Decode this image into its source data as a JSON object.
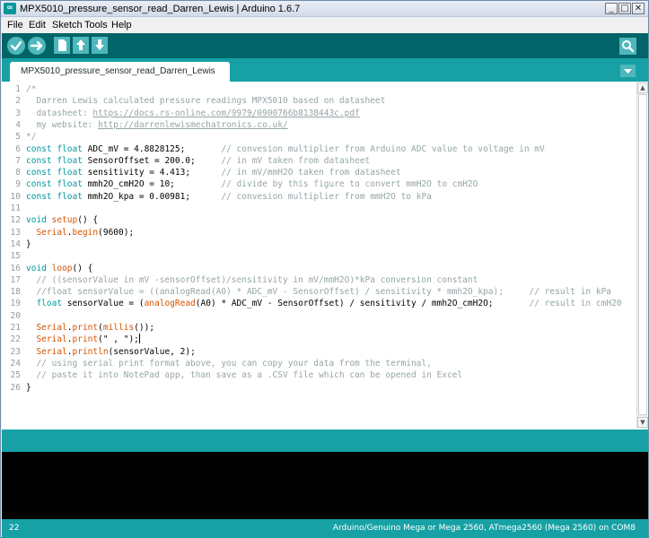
{
  "window": {
    "title": "MPX5010_pressure_sensor_read_Darren_Lewis | Arduino 1.6.7",
    "app_icon_glyph": "∞",
    "minimize_glyph": "_",
    "maximize_glyph": "□",
    "close_glyph": "✕"
  },
  "menu": [
    "File",
    "Edit",
    "Sketch",
    "Tools",
    "Help"
  ],
  "toolbar": {
    "buttons": [
      "verify-icon",
      "upload-icon",
      "new-icon",
      "open-icon",
      "save-icon"
    ],
    "right_button": "serial-monitor-icon"
  },
  "tab": {
    "label": "MPX5010_pressure_sensor_read_Darren_Lewis",
    "menu_icon": "tab-menu-icon"
  },
  "editor": {
    "lines": [
      {
        "n": "1",
        "parts": [
          {
            "t": "/*",
            "c": "cm"
          }
        ]
      },
      {
        "n": "2",
        "parts": [
          {
            "t": "  Darren Lewis calculated pressure readings MPX5010 based on datasheet",
            "c": "cm"
          }
        ]
      },
      {
        "n": "3",
        "parts": [
          {
            "t": "  datasheet: ",
            "c": "cm"
          },
          {
            "t": "https://docs.rs-online.com/9979/0900766b8138443c.pdf",
            "c": "url"
          }
        ]
      },
      {
        "n": "4",
        "parts": [
          {
            "t": "  my website: ",
            "c": "cm"
          },
          {
            "t": "http://darrenlewismechatronics.co.uk/",
            "c": "url"
          }
        ]
      },
      {
        "n": "5",
        "parts": [
          {
            "t": "*/",
            "c": "cm"
          }
        ]
      },
      {
        "n": "6",
        "parts": [
          {
            "t": "const",
            "c": "kw"
          },
          {
            "t": " ",
            "c": ""
          },
          {
            "t": "float",
            "c": "kw"
          },
          {
            "t": " ADC_mV = 4.8828125;       ",
            "c": ""
          },
          {
            "t": "// convesion multiplier from Arduino ADC value to voltage in mV",
            "c": "cm"
          }
        ]
      },
      {
        "n": "7",
        "parts": [
          {
            "t": "const",
            "c": "kw"
          },
          {
            "t": " ",
            "c": ""
          },
          {
            "t": "float",
            "c": "kw"
          },
          {
            "t": " SensorOffset = 200.0;     ",
            "c": ""
          },
          {
            "t": "// in mV taken from datasheet",
            "c": "cm"
          }
        ]
      },
      {
        "n": "8",
        "parts": [
          {
            "t": "const",
            "c": "kw"
          },
          {
            "t": " ",
            "c": ""
          },
          {
            "t": "float",
            "c": "kw"
          },
          {
            "t": " sensitivity = 4.413;      ",
            "c": ""
          },
          {
            "t": "// in mV/mmH2O taken from datasheet",
            "c": "cm"
          }
        ]
      },
      {
        "n": "9",
        "parts": [
          {
            "t": "const",
            "c": "kw"
          },
          {
            "t": " ",
            "c": ""
          },
          {
            "t": "float",
            "c": "kw"
          },
          {
            "t": " mmh2O_cmH2O = 10;         ",
            "c": ""
          },
          {
            "t": "// divide by this figure to convert mmH2O to cmH2O",
            "c": "cm"
          }
        ]
      },
      {
        "n": "10",
        "parts": [
          {
            "t": "const",
            "c": "kw"
          },
          {
            "t": " ",
            "c": ""
          },
          {
            "t": "float",
            "c": "kw"
          },
          {
            "t": " mmh2O_kpa = 0.00981;      ",
            "c": ""
          },
          {
            "t": "// convesion multiplier from mmH2O to kPa",
            "c": "cm"
          }
        ]
      },
      {
        "n": "11",
        "parts": []
      },
      {
        "n": "12",
        "parts": [
          {
            "t": "void",
            "c": "kw"
          },
          {
            "t": " ",
            "c": ""
          },
          {
            "t": "setup",
            "c": "fn"
          },
          {
            "t": "() {",
            "c": ""
          }
        ]
      },
      {
        "n": "13",
        "parts": [
          {
            "t": "  ",
            "c": ""
          },
          {
            "t": "Serial",
            "c": "fn"
          },
          {
            "t": ".",
            "c": ""
          },
          {
            "t": "begin",
            "c": "fn"
          },
          {
            "t": "(9600);",
            "c": ""
          }
        ]
      },
      {
        "n": "14",
        "parts": [
          {
            "t": "}",
            "c": ""
          }
        ]
      },
      {
        "n": "15",
        "parts": []
      },
      {
        "n": "16",
        "parts": [
          {
            "t": "void",
            "c": "kw"
          },
          {
            "t": " ",
            "c": ""
          },
          {
            "t": "loop",
            "c": "fn"
          },
          {
            "t": "() {",
            "c": ""
          }
        ]
      },
      {
        "n": "17",
        "parts": [
          {
            "t": "  // ((sensorValue in mV -sensorOffset)/sensitivity in mV/mmH2O)*kPa conversion constant",
            "c": "cm"
          }
        ]
      },
      {
        "n": "18",
        "parts": [
          {
            "t": "  //float sensorValue = ((analogRead(A0) * ADC_mV - SensorOffset) / sensitivity * mmh2O_kpa);     // result in kPa",
            "c": "cm"
          }
        ]
      },
      {
        "n": "19",
        "parts": [
          {
            "t": "  ",
            "c": ""
          },
          {
            "t": "float",
            "c": "kw"
          },
          {
            "t": " sensorValue = (",
            "c": ""
          },
          {
            "t": "analogRead",
            "c": "fn"
          },
          {
            "t": "(A0) * ADC_mV - SensorOffset) / sensitivity / mmh2O_cmH2O;       ",
            "c": ""
          },
          {
            "t": "// result in cmH20",
            "c": "cm"
          }
        ]
      },
      {
        "n": "20",
        "parts": []
      },
      {
        "n": "21",
        "parts": [
          {
            "t": "  ",
            "c": ""
          },
          {
            "t": "Serial",
            "c": "fn"
          },
          {
            "t": ".",
            "c": ""
          },
          {
            "t": "print",
            "c": "fn"
          },
          {
            "t": "(",
            "c": ""
          },
          {
            "t": "millis",
            "c": "fn"
          },
          {
            "t": "());",
            "c": ""
          }
        ]
      },
      {
        "n": "22",
        "parts": [
          {
            "t": "  ",
            "c": ""
          },
          {
            "t": "Serial",
            "c": "fn"
          },
          {
            "t": ".",
            "c": ""
          },
          {
            "t": "print",
            "c": "fn"
          },
          {
            "t": "(\" , \");",
            "c": ""
          },
          {
            "t": "",
            "c": "caret"
          }
        ]
      },
      {
        "n": "23",
        "parts": [
          {
            "t": "  ",
            "c": ""
          },
          {
            "t": "Serial",
            "c": "fn"
          },
          {
            "t": ".",
            "c": ""
          },
          {
            "t": "println",
            "c": "fn"
          },
          {
            "t": "(sensorValue, 2);",
            "c": ""
          }
        ]
      },
      {
        "n": "24",
        "parts": [
          {
            "t": "  // using serial print format above, you can copy your data from the terminal,",
            "c": "cm"
          }
        ]
      },
      {
        "n": "25",
        "parts": [
          {
            "t": "  // paste it into NotePad app, than save as a .CSV file which can be opened in Excel",
            "c": "cm"
          }
        ]
      },
      {
        "n": "26",
        "parts": [
          {
            "t": "}",
            "c": ""
          }
        ]
      }
    ]
  },
  "status": {
    "line_number": "22",
    "board": "Arduino/Genuino Mega or Mega 2560, ATmega2560 (Mega 2560) on COM8"
  },
  "colors": {
    "toolbar": "#006468",
    "tabbar": "#17a1a5",
    "button": "#4db7bb",
    "keyword": "#00979d",
    "function": "#d35400",
    "comment": "#95a5a6"
  }
}
